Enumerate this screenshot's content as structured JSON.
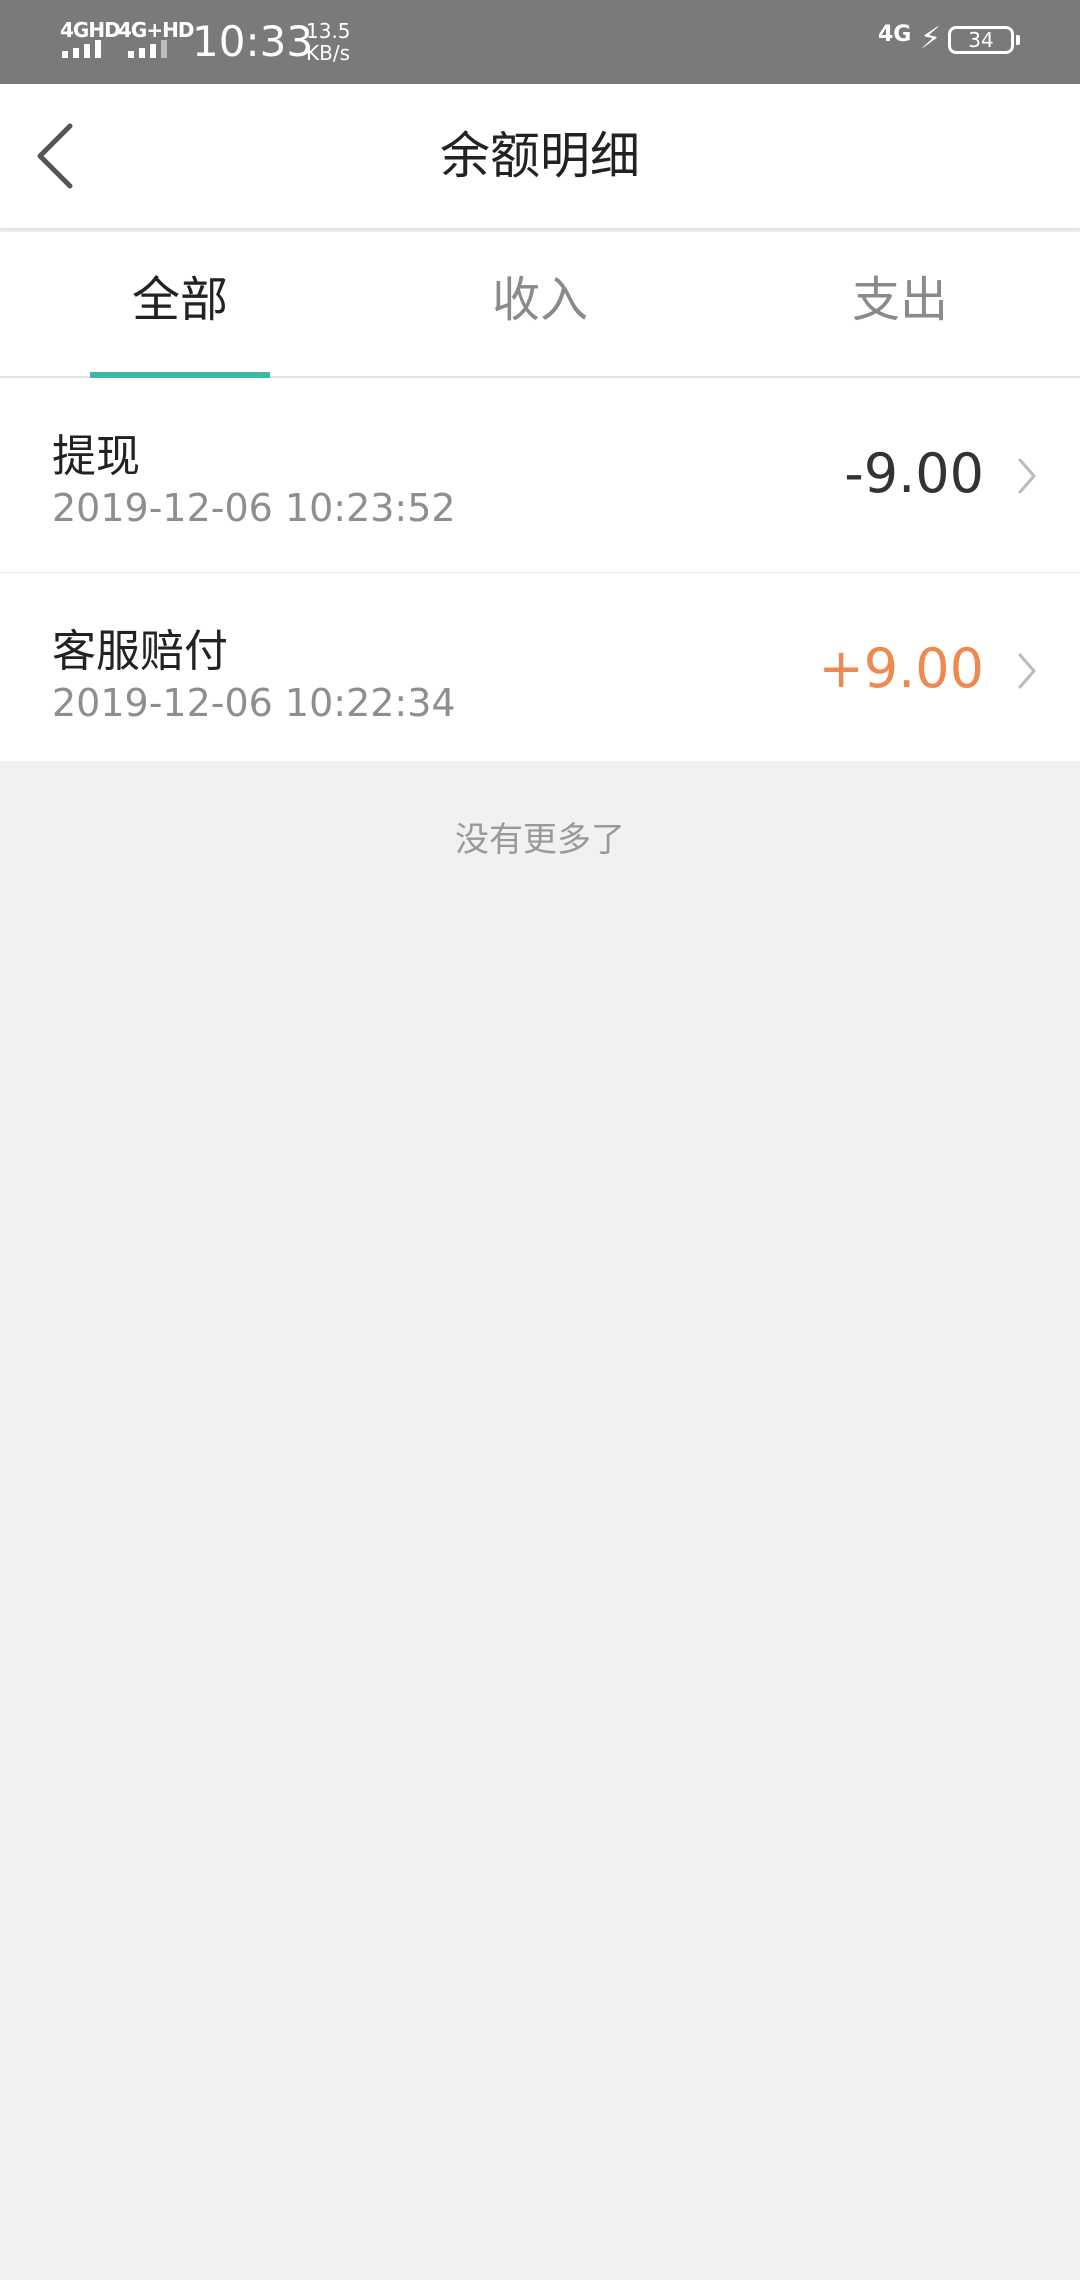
{
  "status_bar": {
    "net1": "4GHD",
    "net2": "4G+HD",
    "time": "10:33",
    "speed_value": "13.5",
    "speed_unit": "KB/s",
    "right_net": "4G",
    "battery": "34"
  },
  "header": {
    "title": "余额明细"
  },
  "tabs": [
    {
      "label": "全部",
      "active": true
    },
    {
      "label": "收入",
      "active": false
    },
    {
      "label": "支出",
      "active": false
    }
  ],
  "transactions": [
    {
      "title": "提现",
      "time": "2019-12-06 10:23:52",
      "amount": "-9.00"
    },
    {
      "title": "客服赔付",
      "time": "2019-12-06 10:22:34",
      "amount": "+9.00"
    }
  ],
  "footer": {
    "no_more": "没有更多了"
  },
  "colors": {
    "accent": "#3fb8a8",
    "income": "#ee8a4f"
  }
}
